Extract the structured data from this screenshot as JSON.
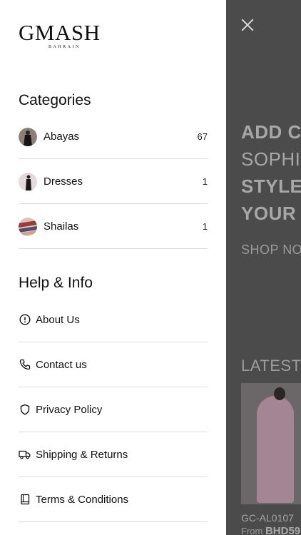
{
  "background": {
    "hero_lines": [
      "ADD C",
      "SOPHIS",
      "STYLES",
      "YOUR V"
    ],
    "shop_now": "SHOP NO",
    "latest": "LATEST I",
    "product": {
      "sku": "GC-AL0107",
      "price_prefix": "From",
      "price": "BHD59"
    }
  },
  "drawer": {
    "logo": {
      "main": "GMASH",
      "sub": "BAHRAIN"
    },
    "categories_title": "Categories",
    "categories": [
      {
        "label": "Abayas",
        "count": "67",
        "icon": "abaya-thumbnail"
      },
      {
        "label": "Dresses",
        "count": "1",
        "icon": "dress-thumbnail"
      },
      {
        "label": "Shailas",
        "count": "1",
        "icon": "shaila-thumbnail"
      }
    ],
    "help_title": "Help & Info",
    "help_items": [
      {
        "label": "About Us",
        "icon": "info-icon"
      },
      {
        "label": "Contact us",
        "icon": "phone-icon"
      },
      {
        "label": "Privacy Policy",
        "icon": "shield-icon"
      },
      {
        "label": "Shipping & Returns",
        "icon": "truck-icon"
      },
      {
        "label": "Terms & Conditions",
        "icon": "book-icon"
      }
    ]
  }
}
